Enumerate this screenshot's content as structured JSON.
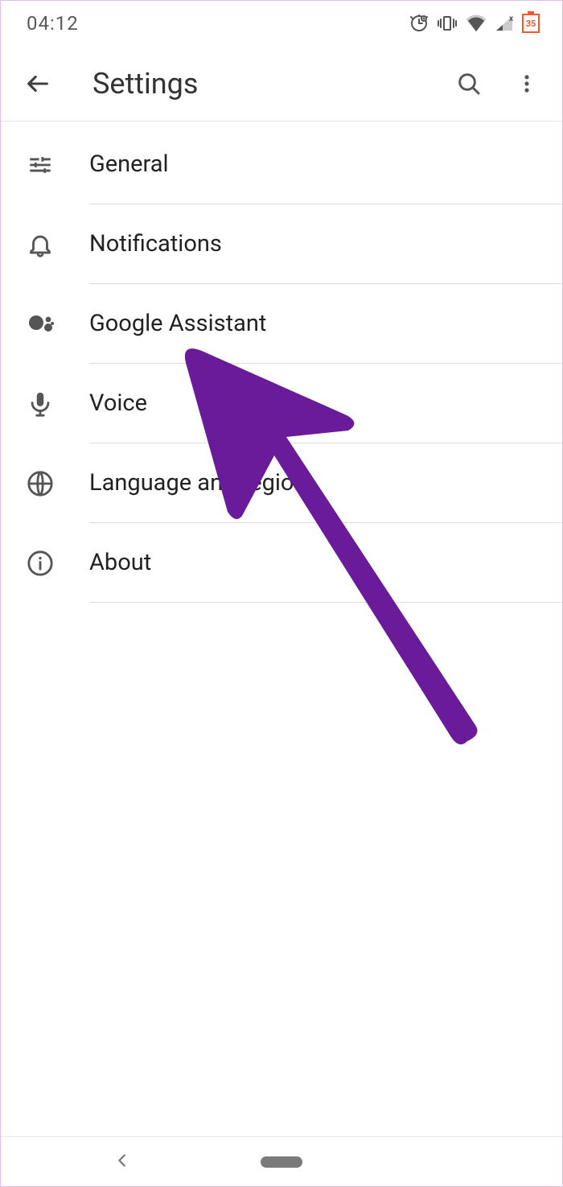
{
  "status": {
    "time": "04:12",
    "battery_label": "35"
  },
  "header": {
    "title": "Settings"
  },
  "settings": {
    "items": [
      {
        "label": "General"
      },
      {
        "label": "Notifications"
      },
      {
        "label": "Google Assistant"
      },
      {
        "label": "Voice"
      },
      {
        "label": "Language and region"
      },
      {
        "label": "About"
      }
    ]
  },
  "annotation": {
    "arrow_color": "#6a1b9a"
  }
}
